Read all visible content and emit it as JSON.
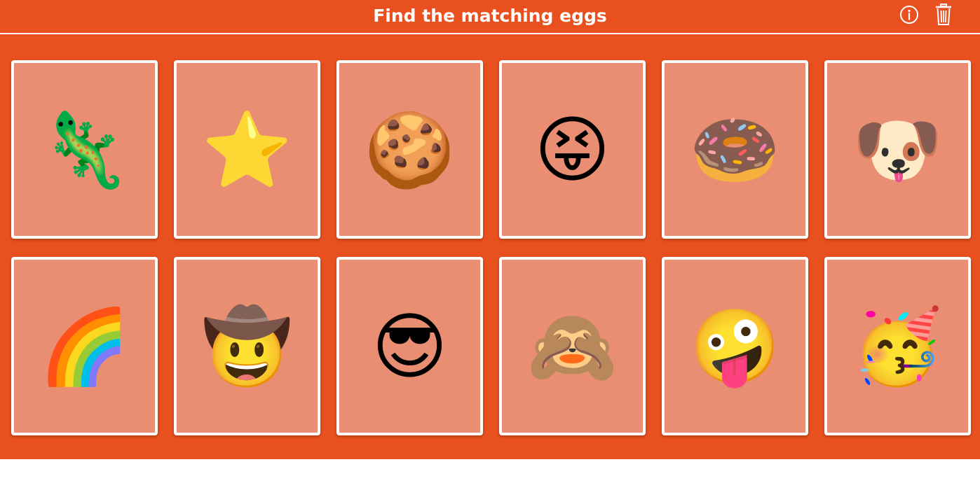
{
  "header": {
    "title": "Find the matching eggs",
    "info_icon": "info-circle-icon",
    "trash_icon": "trash-can-icon"
  },
  "colors": {
    "background": "#e8511f",
    "card_face": "#e98e72",
    "card_border": "#ffffff",
    "header_text": "#ffffff"
  },
  "cards": [
    {
      "name": "lizard",
      "emoji": "🦎"
    },
    {
      "name": "star",
      "emoji": "⭐"
    },
    {
      "name": "cookie",
      "emoji": "🍪"
    },
    {
      "name": "squinting-tongue-face",
      "emoji": "😝"
    },
    {
      "name": "doughnut",
      "emoji": "🍩"
    },
    {
      "name": "dog-face",
      "emoji": "🐶"
    },
    {
      "name": "rainbow",
      "emoji": "🌈"
    },
    {
      "name": "cowboy-face",
      "emoji": "🤠"
    },
    {
      "name": "sunglasses-face",
      "emoji": "😎"
    },
    {
      "name": "see-no-evil-monkey",
      "emoji": "🙈"
    },
    {
      "name": "zany-face",
      "emoji": "🤪"
    },
    {
      "name": "partying-face",
      "emoji": "🥳"
    }
  ]
}
